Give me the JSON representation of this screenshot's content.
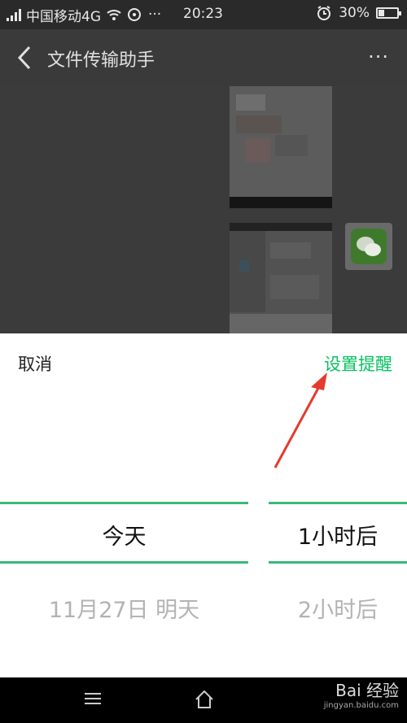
{
  "status_bar": {
    "carrier": "中国移动4G",
    "time": "20:23",
    "battery": "30%",
    "battery_level": 0.3,
    "dots": "···"
  },
  "header": {
    "title": "文件传输助手",
    "more": "···"
  },
  "picker": {
    "cancel_label": "取消",
    "confirm_label": "设置提醒",
    "date_column": {
      "selected": "今天",
      "next": "11月27日 明天"
    },
    "time_column": {
      "selected": "1小时后",
      "next": "2小时后"
    }
  },
  "watermark": {
    "brand": "Bai 经验",
    "url": "jingyan.baidu.com"
  },
  "colors": {
    "accent": "#07c160",
    "picker_line": "#3bb878",
    "annotation_arrow": "#e53a2f"
  },
  "icons": [
    "signal-icon",
    "wifi-icon",
    "alarm-icon",
    "battery-icon",
    "back-icon",
    "more-icon",
    "wechat-icon",
    "menu-icon",
    "home-icon"
  ]
}
